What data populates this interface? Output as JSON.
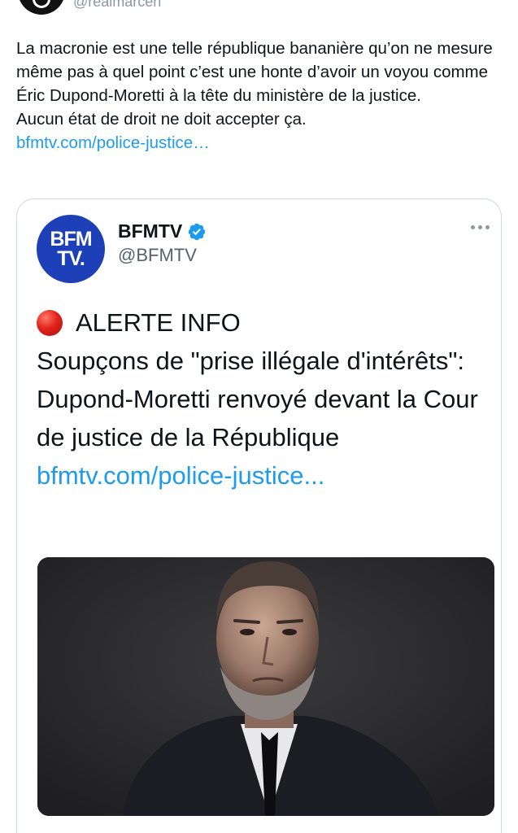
{
  "top": {
    "handle": "@realmarcen"
  },
  "tweet": {
    "lines": [
      "La macronie est une telle république bananière qu’on ne mesure même pas à quel point c’est une honte d’avoir un voyou comme Éric Dupond-Moretti à la tête du ministère de la justice.",
      "Aucun état de droit ne doit accepter ça."
    ],
    "link": "bfmtv.com/police-justice…"
  },
  "quote": {
    "avatar_line1": "BFM",
    "avatar_line2": "TV.",
    "name": "BFMTV",
    "handle": "@BFMTV",
    "alert": "ALERTE INFO",
    "headline": "Soupçons de \"prise illégale d'intérêts\": Dupond-Moretti renvoyé devant la Cour de justice de la République",
    "link": "bfmtv.com/police-justice..."
  },
  "colors": {
    "link": "#1d9bf0",
    "verified": "#1d9bf0",
    "bfm_blue": "#1d3fb8"
  }
}
